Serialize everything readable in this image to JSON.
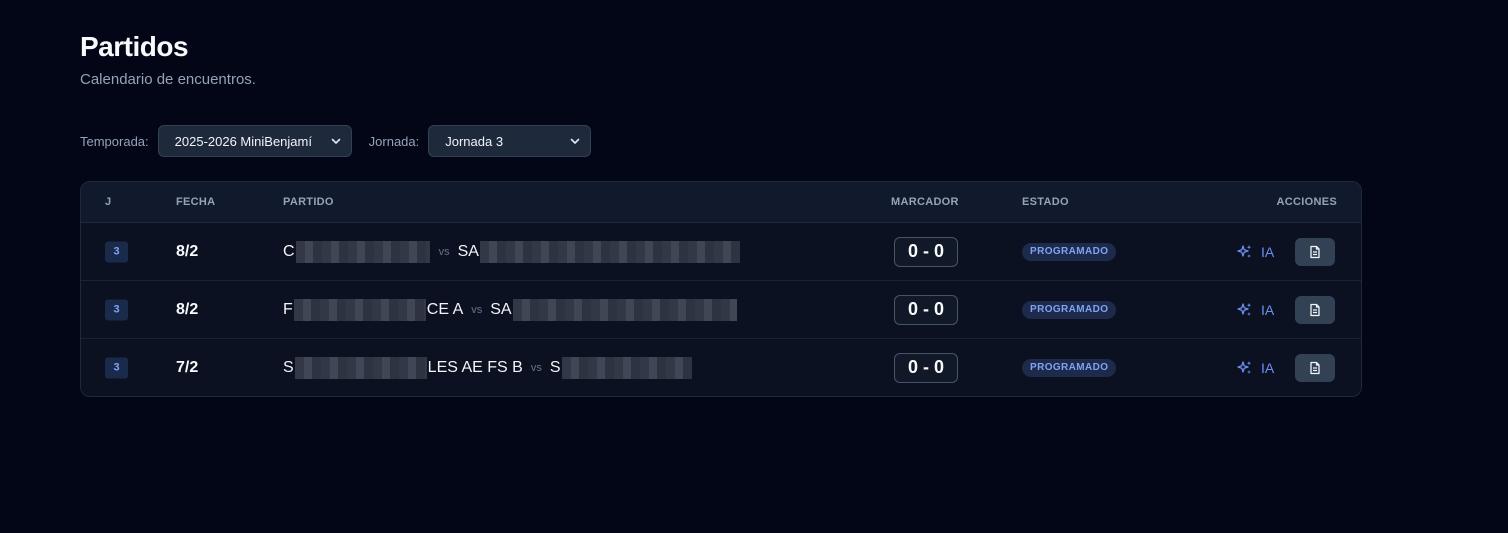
{
  "page": {
    "title": "Partidos",
    "subtitle": "Calendario de encuentros."
  },
  "filters": {
    "season_label": "Temporada:",
    "season_value": "2025-2026 MiniBenjamí",
    "round_label": "Jornada:",
    "round_value": "Jornada 3"
  },
  "table": {
    "headers": {
      "j": "J",
      "fecha": "FECHA",
      "partido": "PARTIDO",
      "marcador": "MARCADOR",
      "estado": "ESTADO",
      "acciones": "ACCIONES"
    },
    "rows": [
      {
        "j": "3",
        "fecha": "8/2",
        "home_prefix": "C",
        "home_suffix": "",
        "vs": "vs",
        "away_prefix": "SA",
        "away_suffix": "",
        "score": "0 - 0",
        "status": "PROGRAMADO",
        "ia_label": "IA"
      },
      {
        "j": "3",
        "fecha": "8/2",
        "home_prefix": "F",
        "home_suffix": "CE A",
        "vs": "vs",
        "away_prefix": "SA",
        "away_suffix": "",
        "score": "0 - 0",
        "status": "PROGRAMADO",
        "ia_label": "IA"
      },
      {
        "j": "3",
        "fecha": "7/2",
        "home_prefix": "S",
        "home_suffix": "LES AE FS B",
        "vs": "vs",
        "away_prefix": "S",
        "away_suffix": "",
        "score": "0 - 0",
        "status": "PROGRAMADO",
        "ia_label": "IA"
      }
    ]
  },
  "icons": {
    "select_chevron": "chevron-down-icon",
    "ai": "sparkles-icon",
    "report": "document-icon"
  },
  "colors": {
    "background": "#030617",
    "accent": "#7ea2f5",
    "status_badge_bg": "#1e2a4a"
  }
}
